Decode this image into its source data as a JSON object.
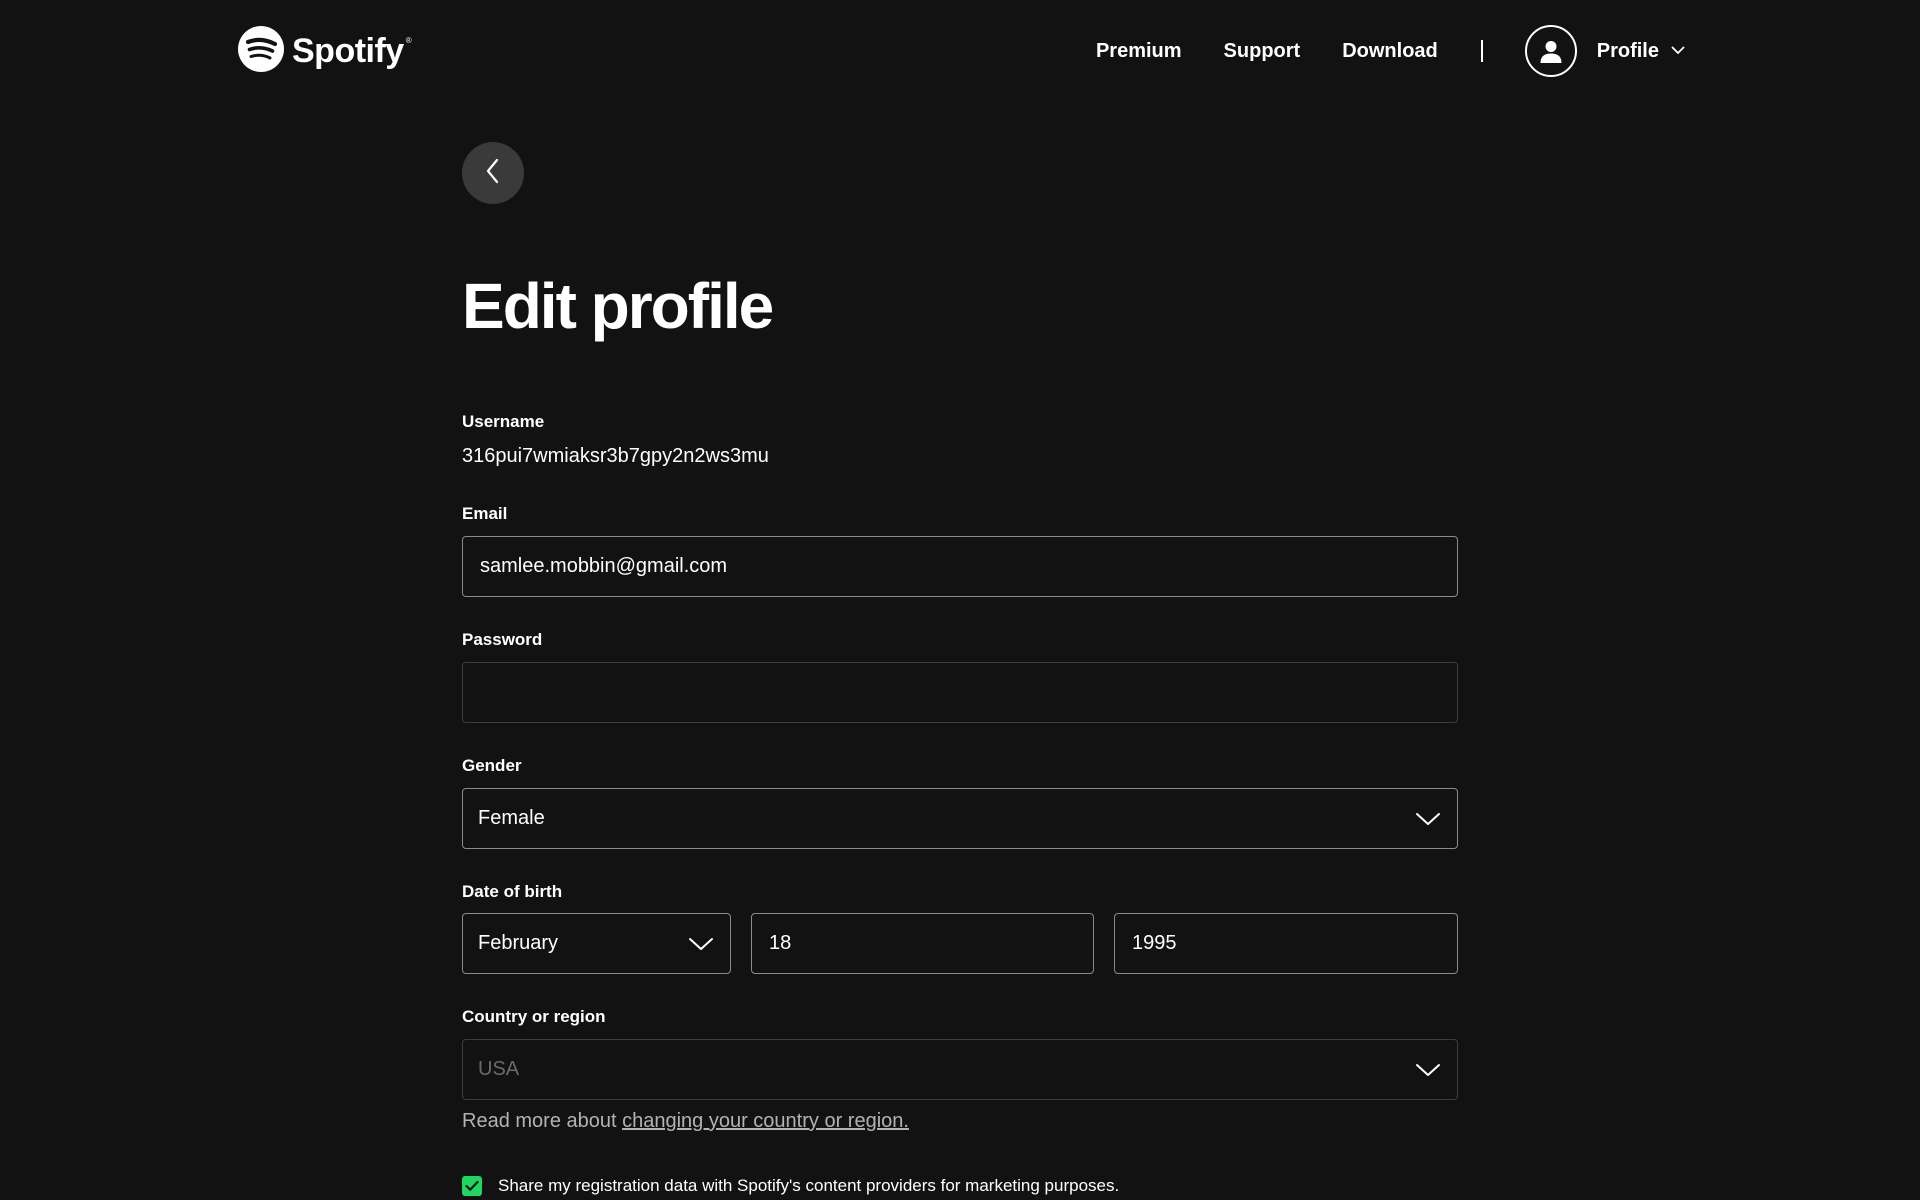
{
  "header": {
    "logo_text": "Spotify",
    "logo_mark": "®",
    "nav": {
      "premium": "Premium",
      "support": "Support",
      "download": "Download"
    },
    "profile_label": "Profile"
  },
  "page": {
    "title": "Edit profile"
  },
  "form": {
    "username": {
      "label": "Username",
      "value": "316pui7wmiaksr3b7gpy2n2ws3mu"
    },
    "email": {
      "label": "Email",
      "value": "samlee.mobbin@gmail.com"
    },
    "password": {
      "label": "Password",
      "value": ""
    },
    "gender": {
      "label": "Gender",
      "value": "Female"
    },
    "dob": {
      "label": "Date of birth",
      "month": "February",
      "day": "18",
      "year": "1995"
    },
    "country": {
      "label": "Country or region",
      "value": "USA",
      "help_prefix": "Read more about ",
      "help_link": "changing your country or region."
    },
    "marketing": {
      "label": "Share my registration data with Spotify's content providers for marketing purposes.",
      "checked": true
    }
  },
  "colors": {
    "background": "#121212",
    "accent": "#1ed760",
    "text": "#ffffff",
    "muted": "#b3b3b3"
  },
  "icons": {
    "logo": "spotify-logo-icon",
    "avatar": "user-icon",
    "profile_caret": "chevron-down-icon",
    "back": "chevron-left-icon",
    "select_caret": "chevron-down-icon",
    "checkbox": "check-icon"
  }
}
